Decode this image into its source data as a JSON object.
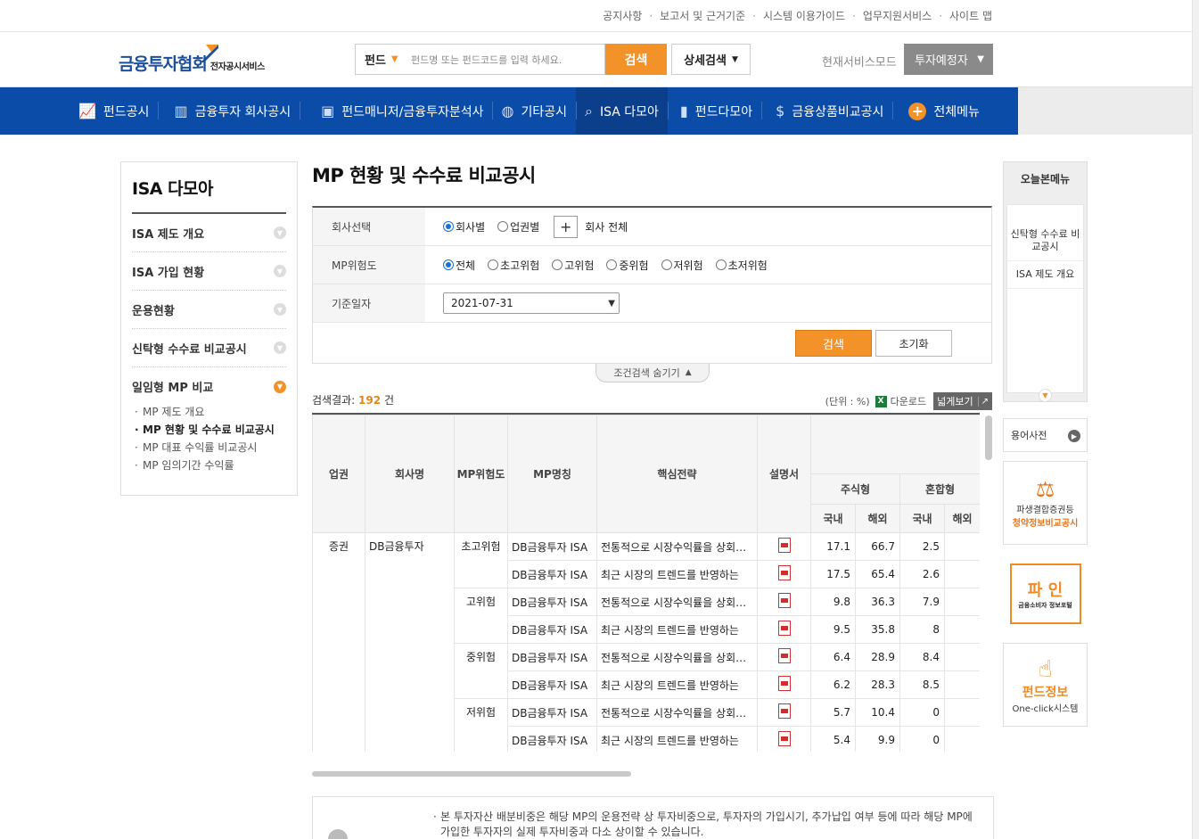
{
  "util_links": [
    "공지사항",
    "보고서 및 근거기준",
    "시스템 이용가이드",
    "업무지원서비스",
    "사이트 맵"
  ],
  "header": {
    "logo_main": "금융투자협회",
    "logo_sub": "전자공시서비스",
    "search_type": "펀드",
    "search_placeholder": "펀드명 또는 펀드코드를 입력 하세요.",
    "search_button": "검색",
    "detail_search": "상세검색",
    "mode_label": "현재서비스모드",
    "mode_value": "투자예정자"
  },
  "gnb": [
    {
      "label": "펀드공시",
      "icon": "chart-icon"
    },
    {
      "label": "금융투자 회사공시",
      "icon": "building-icon"
    },
    {
      "label": "펀드매니저/금융투자분석사",
      "icon": "briefcase-icon"
    },
    {
      "label": "기타공시",
      "icon": "globe-icon"
    },
    {
      "label": "ISA 다모아",
      "icon": "magnifier-icon"
    },
    {
      "label": "펀드다모아",
      "icon": "bars-icon"
    },
    {
      "label": "금융상품비교공시",
      "icon": "dollar-search-icon"
    },
    {
      "label": "전체메뉴",
      "icon": "plus-circle-icon"
    }
  ],
  "sidebar": {
    "title": "ISA 다모아",
    "items": [
      {
        "label": "ISA 제도 개요"
      },
      {
        "label": "ISA 가입 현황"
      },
      {
        "label": "운용현황"
      },
      {
        "label": "신탁형 수수료 비교공시"
      },
      {
        "label": "일임형 MP 비교"
      }
    ],
    "subitems": [
      {
        "label": "MP 제도 개요"
      },
      {
        "label": "MP 현황 및 수수료 비교공시"
      },
      {
        "label": "MP 대표 수익률 비교공시"
      },
      {
        "label": "MP 임의기간 수익률"
      }
    ]
  },
  "main": {
    "title": "MP 현황 및 수수료 비교공시",
    "filter": {
      "company_label": "회사선택",
      "company_opts": [
        "회사별",
        "업권별"
      ],
      "company_all": "회사 전체",
      "risk_label": "MP위험도",
      "risk_opts": [
        "전체",
        "초고위험",
        "고위험",
        "중위험",
        "저위험",
        "초저위험"
      ],
      "date_label": "기준일자",
      "date_value": "2021-07-31",
      "search_btn": "검색",
      "reset_btn": "초기화",
      "hide_toggle": "조건검색 숨기기"
    },
    "result": {
      "prefix": "검색결과:",
      "count": "192",
      "suffix": "건",
      "unit": "(단위 : %)",
      "download": "다운로드",
      "wide_view": "넓게보기"
    },
    "table": {
      "headers": {
        "sector": "업권",
        "company": "회사명",
        "risk": "MP위험도",
        "mp_name": "MP명칭",
        "strategy": "핵심전략",
        "prospectus": "설명서",
        "stock": "주식형",
        "mixed": "혼합형",
        "domestic": "국내",
        "overseas": "해외"
      },
      "sector": "증권",
      "company": "DB금융투자",
      "risk_groups": [
        "초고위험",
        "고위험",
        "중위험",
        "저위험"
      ],
      "rows": [
        {
          "mp": "DB금융투자 ISA",
          "strategy": "전통적으로 시장수익률을 상회하는",
          "v1": "17.1",
          "v2": "66.7",
          "v3": "2.5"
        },
        {
          "mp": "DB금융투자 ISA",
          "strategy": "최근 시장의 트렌드를 반영하는",
          "v1": "17.5",
          "v2": "65.4",
          "v3": "2.6"
        },
        {
          "mp": "DB금융투자 ISA",
          "strategy": "전통적으로 시장수익률을 상회하는",
          "v1": "9.8",
          "v2": "36.3",
          "v3": "7.9"
        },
        {
          "mp": "DB금융투자 ISA",
          "strategy": "최근 시장의 트렌드를 반영하는",
          "v1": "9.5",
          "v2": "35.8",
          "v3": "8"
        },
        {
          "mp": "DB금융투자 ISA",
          "strategy": "전통적으로 시장수익률을 상회하는",
          "v1": "6.4",
          "v2": "28.9",
          "v3": "8.4"
        },
        {
          "mp": "DB금융투자 ISA",
          "strategy": "최근 시장의 트렌드를 반영하는",
          "v1": "6.2",
          "v2": "28.3",
          "v3": "8.5"
        },
        {
          "mp": "DB금융투자 ISA",
          "strategy": "전통적으로 시장수익률을 상회하는",
          "v1": "5.7",
          "v2": "10.4",
          "v3": "0"
        },
        {
          "mp": "DB금융투자 ISA",
          "strategy": "최근 시장의 트렌드를 반영하는",
          "v1": "5.4",
          "v2": "9.9",
          "v3": "0"
        }
      ]
    },
    "note": "본 투자자산 배분비중은 해당 MP의 운용전략 상 투자비중으로, 투자자의 가입시기, 추가납입 여부 등에 따라 해당 MP에 가입한 투자자의 실제 투자비중과 다소 상이할 수 있습니다."
  },
  "quick": {
    "title": "오늘본메뉴",
    "items": [
      "신탁형 수수료 비교공시",
      "ISA 제도 개요"
    ],
    "dict": "용어사전"
  },
  "banners": {
    "b1_line1": "파생결합증권등",
    "b1_line2": "청약정보비교공시",
    "b2_main": "파 인",
    "b2_sub": "금융소비자 정보포털",
    "b3_line1": "펀드정보",
    "b3_line2": "One-click시스템"
  }
}
